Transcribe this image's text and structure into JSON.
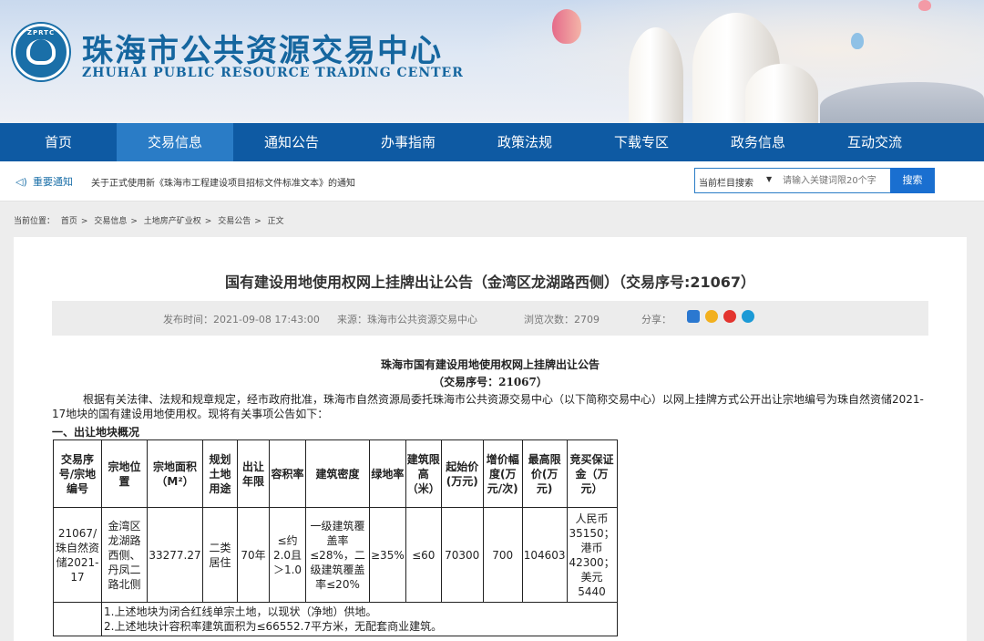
{
  "header": {
    "logo_abbr": "ZPRTC",
    "title": "珠海市公共资源交易中心",
    "subtitle": "ZHUHAI PUBLIC RESOURCE TRADING CENTER"
  },
  "nav": {
    "items": [
      "首页",
      "交易信息",
      "通知公告",
      "办事指南",
      "政策法规",
      "下载专区",
      "政务信息",
      "互动交流"
    ],
    "active_index": 1
  },
  "notice": {
    "label": "重要通知",
    "text": "关于正式使用新《珠海市工程建设项目招标文件标准文本》的通知"
  },
  "search": {
    "scope": "当前栏目搜索",
    "placeholder": "请输入关键词限20个字",
    "button": "搜索"
  },
  "breadcrumb": {
    "prefix": "当前位置：",
    "items": [
      "首页",
      "交易信息",
      "土地房产矿业权",
      "交易公告",
      "正文"
    ]
  },
  "article": {
    "title": "国有建设用地使用权网上挂牌出让公告（金湾区龙湖路西侧）（交易序号:21067）",
    "publish_time": "发布时间：2021-09-08 17:43:00",
    "source": "来源：珠海市公共资源交易中心",
    "views": "浏览次数：2709",
    "share_label": "分享："
  },
  "document": {
    "title": "珠海市国有建设用地使用权网上挂牌出让公告",
    "subtitle": "（交易序号：21067）",
    "paragraph": "根据有关法律、法规和规章规定，经市政府批准，珠海市自然资源局委托珠海市公共资源交易中心（以下简称交易中心）以网上挂牌方式公开出让宗地编号为珠自然资储2021-17地块的国有建设用地使用权。现将有关事项公告如下：",
    "section": "一、出让地块概况",
    "table": {
      "headers": [
        "交易序号/宗地编号",
        "宗地位置",
        "宗地面积（M²）",
        "规划土地用途",
        "出让年限",
        "容积率",
        "建筑密度",
        "绿地率",
        "建筑限高（米）",
        "起始价(万元)",
        "增价幅度(万元/次)",
        "最高限价(万元)",
        "竞买保证金（万元）"
      ],
      "row": [
        "21067/珠自然资储2021-17",
        "金湾区龙湖路西侧、丹凤二路北侧",
        "33277.27",
        "二类居住",
        "70年",
        "≤约2.0且＞1.0",
        "一级建筑覆盖率≤28%，二级建筑覆盖率≤20%",
        "≥35%",
        "≤60",
        "70300",
        "700",
        "104603",
        "人民币35150；港币42300；美元5440"
      ],
      "notes": [
        "1.上述地块为闭合红线单宗土地，以现状（净地）供地。",
        "2.上述地块计容积率建筑面积为≤66552.7平方米，无配套商业建筑。"
      ]
    }
  },
  "colors": {
    "brand_blue": "#0e5aa3",
    "nav_active": "#2a7cc6",
    "title_blue": "#15669f"
  }
}
